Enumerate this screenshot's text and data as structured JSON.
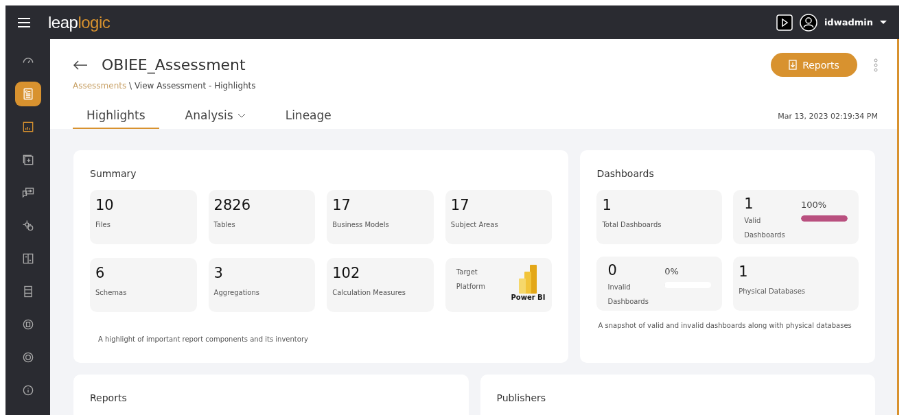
{
  "topbar": {
    "logo_part_1": "leap",
    "logo_part_2": "logic",
    "user": "idwadmin"
  },
  "sidebar": {
    "items": [
      {
        "selected": false
      },
      {
        "selected": true
      },
      {
        "selected": false
      },
      {
        "selected": false
      },
      {
        "selected": false
      },
      {
        "selected": false
      },
      {
        "selected": false
      },
      {
        "selected": false
      },
      {
        "selected": false
      },
      {
        "selected": false
      },
      {
        "selected": false
      }
    ]
  },
  "header": {
    "title": "OBIEE_Assessment",
    "breadcrumb": [
      {
        "label": "Assessments",
        "link": true
      },
      {
        "label": " \\ View Assessment - Highlights",
        "link": false
      }
    ],
    "reports_button": "Reports",
    "timestamp": "Mar 13, 2023 02:19:34 PM"
  },
  "tabs": [
    {
      "label": "Highlights",
      "selected": true,
      "dropdown": false
    },
    {
      "label": "Analysis",
      "selected": false,
      "dropdown": true
    },
    {
      "label": "Lineage",
      "selected": false,
      "dropdown": false
    }
  ],
  "summary": {
    "title": "Summary",
    "stats": [
      {
        "kind": "stat",
        "value": "10",
        "label": "Files"
      },
      {
        "kind": "stat",
        "value": "2826",
        "label": "Tables"
      },
      {
        "kind": "stat",
        "value": "17",
        "label": "Business Models"
      },
      {
        "kind": "stat",
        "value": "17",
        "label": "Subject Areas"
      },
      {
        "kind": "stat",
        "value": "6",
        "label": "Schemas"
      },
      {
        "kind": "stat",
        "value": "3",
        "label": "Aggregations"
      },
      {
        "kind": "stat",
        "value": "102",
        "label": "Calculation Measures"
      },
      {
        "kind": "platform",
        "label_1": "Target",
        "label_2": "Platform",
        "value": "Power BI"
      }
    ],
    "note": "A highlight of important report components and its inventory"
  },
  "dashboards": {
    "title": "Dashboards",
    "stats": [
      {
        "kind": "stat",
        "value": "1",
        "label": "Total Dashboards"
      },
      {
        "kind": "meter",
        "value": "1",
        "label_1": "Valid",
        "label_2": "Dashboards",
        "percent": "100%",
        "level": 1,
        "color": "#b9507f"
      },
      {
        "kind": "meter",
        "value": "0",
        "label_1": "Invalid",
        "label_2": "Dashboards",
        "percent": "0%",
        "level": 0
      },
      {
        "kind": "stat",
        "value": "1",
        "label": "Physical Databases"
      }
    ],
    "note": "A snapshot of valid and invalid dashboards along with physical databases"
  },
  "bottom_cards": [
    {
      "title": "Reports"
    },
    {
      "title": "Publishers"
    }
  ]
}
